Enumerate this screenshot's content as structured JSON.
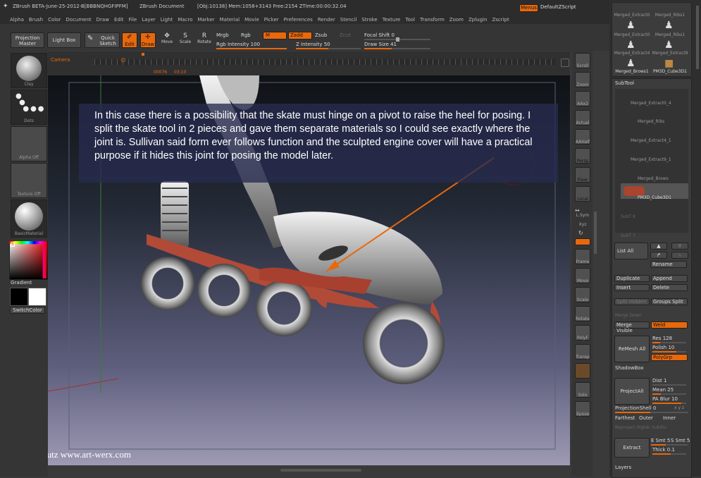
{
  "title": {
    "app": "ZBrush BETA-June-25-2012-B[BBBNQHGFIPFM]",
    "doc": "ZBrush Document",
    "stats": "[Obj:10138] Mem:1058+3143 Free:2154 ZTime:00:00:32.04",
    "menus": "Menus",
    "script": "DefaultZScript"
  },
  "menu_items": [
    "Alpha",
    "Brush",
    "Color",
    "Document",
    "Draw",
    "Edit",
    "File",
    "Layer",
    "Light",
    "Macro",
    "Marker",
    "Material",
    "Movie",
    "Picker",
    "Preferences",
    "Render",
    "Stencil",
    "Stroke",
    "Texture",
    "Tool",
    "Transform",
    "Zoom",
    "Zplugin",
    "Zscript"
  ],
  "toolbar": {
    "projection_master": "Projection Master",
    "lightbox": "Light Box",
    "quick_sketch": "Quick Sketch",
    "edit": "Edit",
    "draw": "Draw",
    "move": "Move",
    "scale": "Scale",
    "rotate": "Rotate",
    "mrgb": "Mrgb",
    "rgb": "Rgb",
    "m": "M",
    "zadd": "Zadd",
    "zsub": "Zsub",
    "zcut": "Zcut",
    "rgb_intensity": "Rgb Intensity 100",
    "z_intensity": "Z Intensity 50",
    "focal_shift": "Focal Shift 0",
    "draw_size": "Draw Size 41",
    "rgb_intensity_value": 100,
    "z_intensity_value": 50,
    "draw_size_value": 41
  },
  "timeline": {
    "camera": "Camera",
    "frame": "00076",
    "time": "03:10"
  },
  "left_shelf": {
    "clay": "Clay",
    "dots": "Dots",
    "alpha": "Alpha Off",
    "texture": "Texture Off",
    "material": "BasicMaterial",
    "gradient": "Gradient",
    "switchcolor": "SwitchColor"
  },
  "canvas": {
    "annotation": "In this case there is a possibility that the skate must hinge on a pivot to raise the heel for posing. I split the skate tool in 2 pieces and gave them separate materials so I could see exactly where the joint is. Sullivan said form ever follows function and the sculpted engine cover will have a practical purpose if it hides this joint for posing the model later.",
    "credit": "Chris Kautz www.art-werx.com"
  },
  "right_toolbar": [
    "Scroll",
    "Zoom",
    "AAx2",
    "Actual",
    "AAHalf",
    "Persp",
    "Floor",
    "Local",
    "L.Sym",
    "Xyz",
    "",
    "",
    "Frame",
    "Move",
    "Scale",
    "Rotate",
    "PolyF",
    "Transp",
    "",
    "Solo",
    "Xpose"
  ],
  "tool_thumbs": [
    "Merged_Extract0",
    "Merged_Ribs1",
    "Merged_Extract4",
    "Merged_Extract9",
    "Merged_Brows1",
    "PM3D_Cube3D1"
  ],
  "subtool": {
    "header": "SubTool",
    "items": [
      "Merged_Extract0_4",
      "Merged_Ribs",
      "Merged_Extract4_1",
      "Merged_Extract9_1",
      "Merged_Brows",
      "PM3D_Cube3D1",
      "SubT 8",
      "SubT 7"
    ],
    "list_all": "List All",
    "rename": "Rename",
    "duplicate": "Duplicate",
    "append": "Append",
    "insert": "Insert",
    "delete": "Delete",
    "split_hidden": "Split Hidden",
    "groups_split": "Groups Split",
    "merge_down": "Merge Down",
    "merge_visible": "Merge Visible",
    "weld": "Weld",
    "remesh_all": "ReMesh All",
    "res": "Res 128",
    "polish": "Polish 10",
    "polygrp": "PolyGrp",
    "shadowbox": "ShadowBox",
    "project_all": "ProjectAll",
    "dist": "Dist 1",
    "mean": "Mean 25",
    "pa_blur": "PA Blur 10",
    "projection_shell": "ProjectionShell 0",
    "farthest": "Farthest",
    "outer": "Outer",
    "inner": "Inner",
    "reproject": "Reproject Higher Subdiv",
    "extract": "Extract",
    "e_smt": "E Smt 5",
    "s_smt": "S Smt 5",
    "thick": "Thick 0.1",
    "layers": "Layers"
  },
  "colors": {
    "accent": "#e8680c",
    "panel": "#3c3c3c",
    "canvas_top": "#111418",
    "canvas_bottom": "#9e9ab4"
  }
}
